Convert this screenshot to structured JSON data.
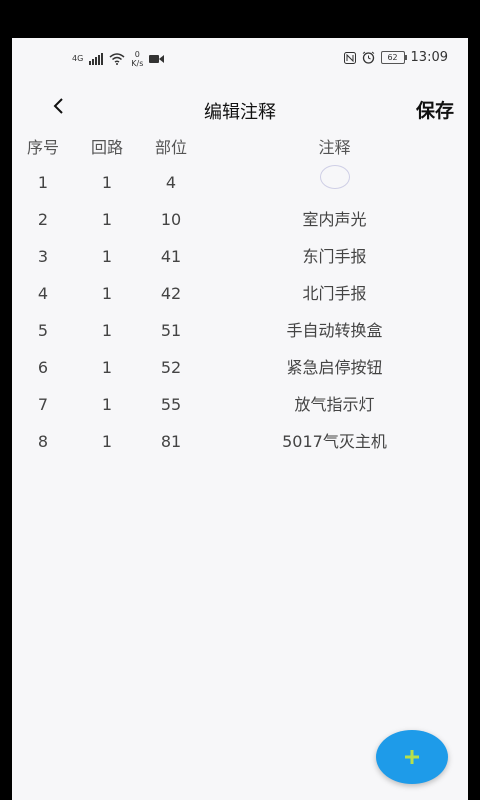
{
  "status_bar": {
    "network": "4G",
    "speed_value": "0",
    "speed_unit": "K/s",
    "battery": "62",
    "time": "13:09",
    "icons": [
      "signal-icon",
      "wifi-icon",
      "video-icon",
      "nfc-icon",
      "alarm-icon",
      "battery-icon"
    ]
  },
  "header": {
    "title": "编辑注释",
    "save_label": "保存",
    "back_icon": "chevron-left-icon"
  },
  "table": {
    "columns": [
      "序号",
      "回路",
      "部位",
      "注释"
    ],
    "rows": [
      {
        "seq": "1",
        "loop": "1",
        "part": "4",
        "note": ""
      },
      {
        "seq": "2",
        "loop": "1",
        "part": "10",
        "note": "室内声光"
      },
      {
        "seq": "3",
        "loop": "1",
        "part": "41",
        "note": "东门手报"
      },
      {
        "seq": "4",
        "loop": "1",
        "part": "42",
        "note": "北门手报"
      },
      {
        "seq": "5",
        "loop": "1",
        "part": "51",
        "note": "手自动转换盒"
      },
      {
        "seq": "6",
        "loop": "1",
        "part": "52",
        "note": "紧急启停按钮"
      },
      {
        "seq": "7",
        "loop": "1",
        "part": "55",
        "note": "放气指示灯"
      },
      {
        "seq": "8",
        "loop": "1",
        "part": "81",
        "note": "5017气灭主机"
      }
    ]
  },
  "fab": {
    "icon": "plus-icon",
    "colors": {
      "background": "#1e9be9",
      "icon": "#b8e04a"
    }
  }
}
